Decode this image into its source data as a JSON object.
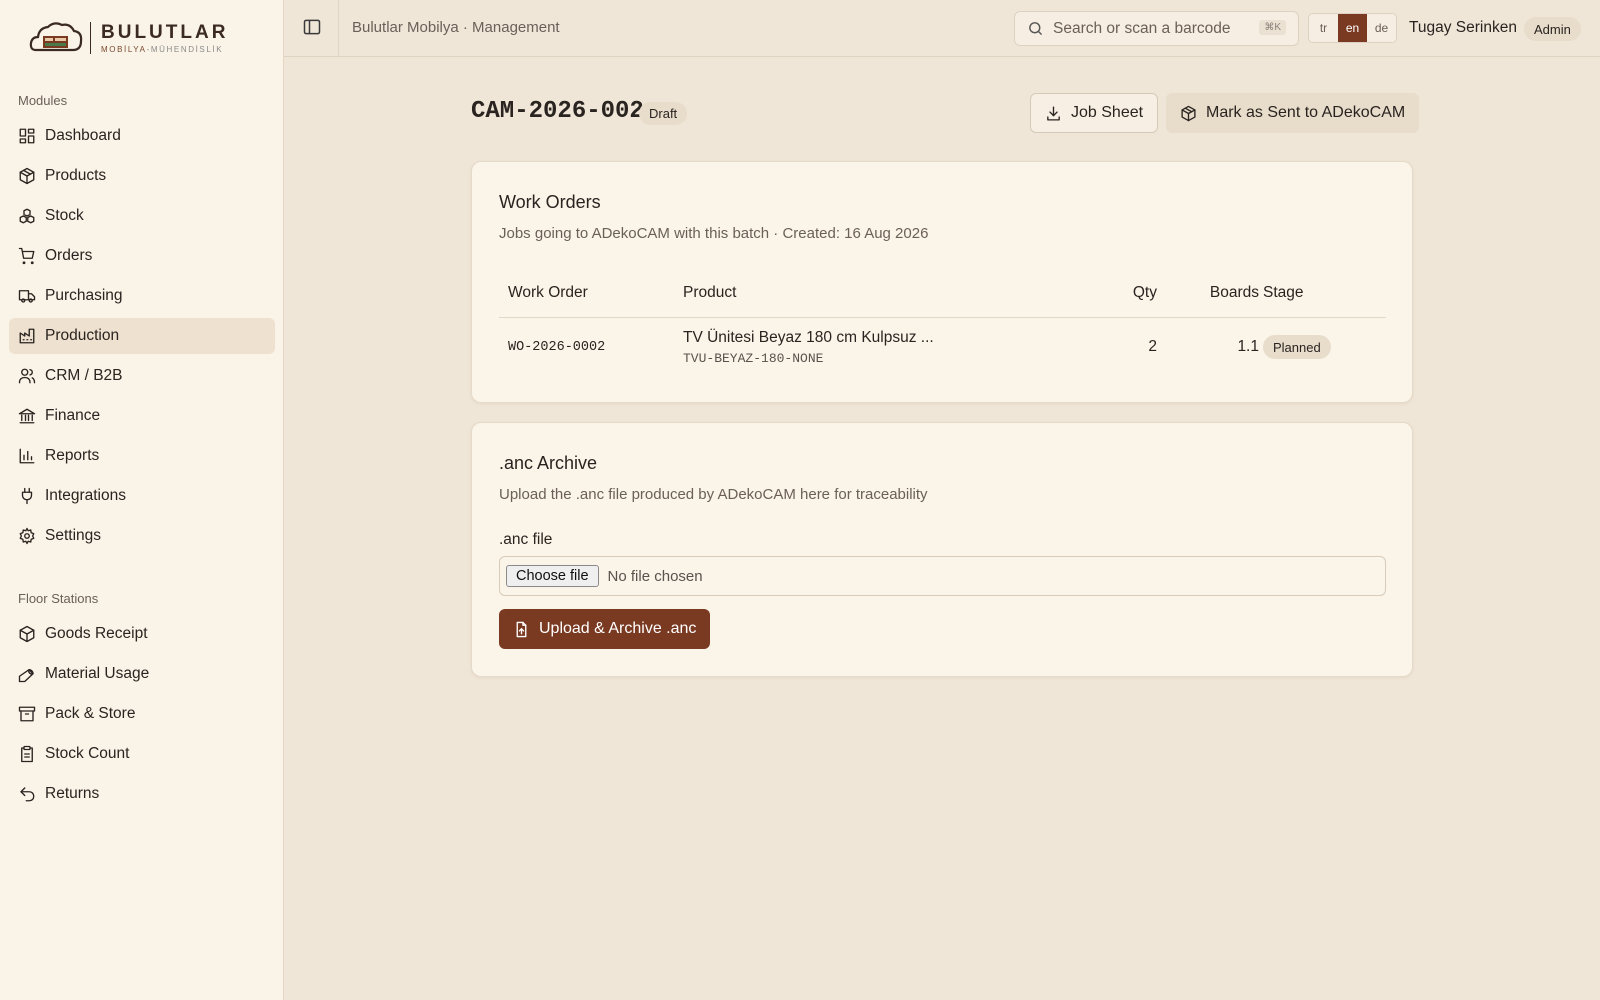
{
  "brand": {
    "title": "BULUTLAR",
    "subtitle_main": "MOBİLYA",
    "subtitle_sep": "-",
    "subtitle_accent": "MÜHENDİSLİK"
  },
  "sidebar": {
    "modules_label": "Modules",
    "modules": [
      {
        "label": "Dashboard",
        "icon": "dashboard-icon"
      },
      {
        "label": "Products",
        "icon": "box-icon"
      },
      {
        "label": "Stock",
        "icon": "boxes-icon"
      },
      {
        "label": "Orders",
        "icon": "cart-icon"
      },
      {
        "label": "Purchasing",
        "icon": "truck-icon"
      },
      {
        "label": "Production",
        "icon": "factory-icon",
        "active": true
      },
      {
        "label": "CRM / B2B",
        "icon": "users-icon"
      },
      {
        "label": "Finance",
        "icon": "bank-icon"
      },
      {
        "label": "Reports",
        "icon": "bar-chart-icon"
      },
      {
        "label": "Integrations",
        "icon": "plug-icon"
      },
      {
        "label": "Settings",
        "icon": "gear-icon"
      }
    ],
    "floor_label": "Floor Stations",
    "floor": [
      {
        "label": "Goods Receipt",
        "icon": "package-icon"
      },
      {
        "label": "Material Usage",
        "icon": "wrench-icon"
      },
      {
        "label": "Pack & Store",
        "icon": "archive-icon"
      },
      {
        "label": "Stock Count",
        "icon": "clipboard-icon"
      },
      {
        "label": "Returns",
        "icon": "undo-icon"
      }
    ]
  },
  "header": {
    "breadcrumb": "Bulutlar Mobilya · Management",
    "search_placeholder": "Search or scan a barcode",
    "search_shortcut": "⌘K",
    "languages": [
      "tr",
      "en",
      "de"
    ],
    "active_language": "en",
    "user_name": "Tugay Serinken",
    "user_role": "Admin"
  },
  "page": {
    "title": "CAM-2026-002",
    "status": "Draft",
    "job_sheet_label": "Job Sheet",
    "mark_sent_label": "Mark as Sent to ADekoCAM"
  },
  "work_orders": {
    "title": "Work Orders",
    "description": "Jobs going to ADekoCAM with this batch · Created: 16 Aug 2026",
    "columns": {
      "work_order": "Work Order",
      "product": "Product",
      "qty": "Qty",
      "boards": "Boards",
      "stage": "Stage"
    },
    "rows": [
      {
        "work_order": "WO-2026-0002",
        "product_name": "TV Ünitesi Beyaz 180 cm Kulpsuz ...",
        "product_sku": "TVU-BEYAZ-180-NONE",
        "qty": "2",
        "boards": "1.1",
        "stage": "Planned"
      }
    ]
  },
  "archive": {
    "title": ".anc Archive",
    "description": "Upload the .anc file produced by ADekoCAM here for traceability",
    "field_label": ".anc file",
    "choose_label": "Choose file",
    "no_file_label": "No file chosen",
    "upload_label": "Upload & Archive .anc"
  },
  "colors": {
    "accent": "#7a3a22",
    "background": "#f0e6d8",
    "sidebar": "#faf3e8",
    "card": "#fbf4e9"
  }
}
